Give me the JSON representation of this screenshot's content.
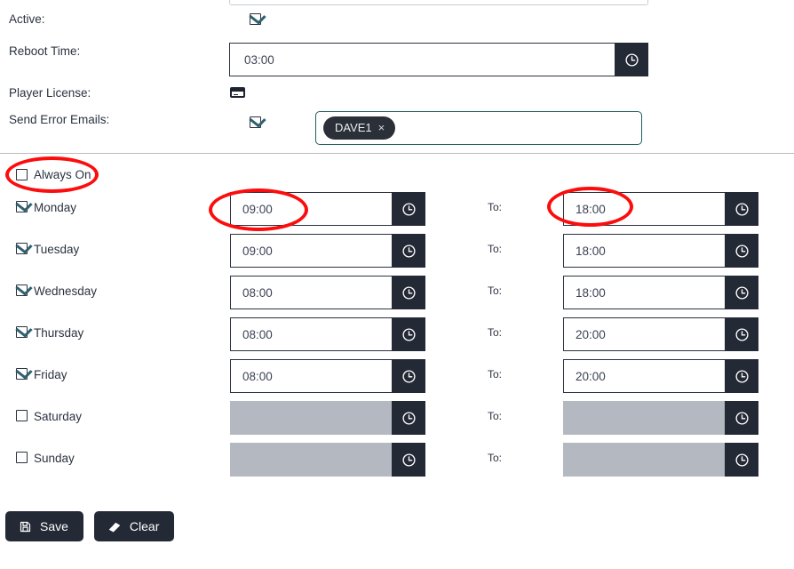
{
  "form": {
    "fields": [
      {
        "label": "Active:",
        "checked": true
      },
      {
        "label": "Reboot Time:",
        "value": "03:00"
      },
      {
        "label": "Player License:",
        "icon": "credit-card-icon"
      },
      {
        "label": "Send Error Emails:",
        "checked": true
      }
    ],
    "reboot_time": "03:00",
    "error_email_tags": [
      {
        "name": "DAVE1",
        "remove": "×"
      }
    ]
  },
  "schedule": {
    "always_on": {
      "label": "Always On",
      "checked": false
    },
    "to_label": "To:",
    "rows": [
      {
        "day": "Monday",
        "checked": true,
        "from": "09:00",
        "to": "18:00",
        "enabled": true
      },
      {
        "day": "Tuesday",
        "checked": true,
        "from": "09:00",
        "to": "18:00",
        "enabled": true
      },
      {
        "day": "Wednesday",
        "checked": true,
        "from": "08:00",
        "to": "18:00",
        "enabled": true
      },
      {
        "day": "Thursday",
        "checked": true,
        "from": "08:00",
        "to": "20:00",
        "enabled": true
      },
      {
        "day": "Friday",
        "checked": true,
        "from": "08:00",
        "to": "20:00",
        "enabled": true
      },
      {
        "day": "Saturday",
        "checked": false,
        "from": "",
        "to": "",
        "enabled": false
      },
      {
        "day": "Sunday",
        "checked": false,
        "from": "",
        "to": "",
        "enabled": false
      }
    ]
  },
  "actions": {
    "save_label": "Save",
    "clear_label": "Clear"
  },
  "colors": {
    "dark": "#242936",
    "text": "#2b3240",
    "disabled_field": "#b4b9c1",
    "multiselect_border": "#1f5f5b",
    "annotation": "#fc0d0d"
  }
}
